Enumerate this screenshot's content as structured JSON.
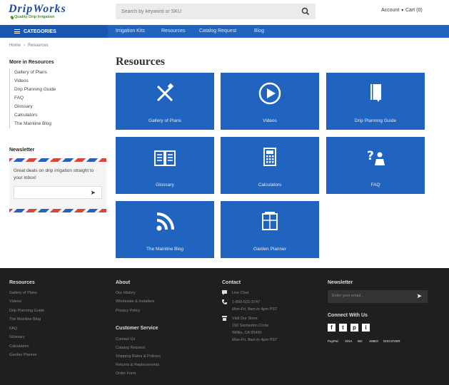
{
  "header": {
    "logo_text": "DripWorks",
    "logo_tagline": "Quality Drip Irrigation",
    "search_placeholder": "Search by keyword or SKU",
    "account_label": "Account",
    "cart_label": "Cart (0)"
  },
  "nav": {
    "categories_label": "CATEGORIES",
    "links": [
      "Irrigation Kits",
      "Resources",
      "Catalog Request",
      "Blog"
    ]
  },
  "breadcrumb": [
    "Home",
    "Resources"
  ],
  "sidebar": {
    "heading": "More in Resources",
    "items": [
      "Gallery of Plans",
      "Videos",
      "Drip Planning Guide",
      "FAQ",
      "Glossary",
      "Calculators",
      "The Mainline Blog"
    ],
    "newsletter_heading": "Newsletter",
    "newsletter_text": "Great deals on drip irrigation straight to your inbox!"
  },
  "main": {
    "title": "Resources",
    "tiles": [
      {
        "label": "Gallery of Plans",
        "icon": "pencil-ruler-icon"
      },
      {
        "label": "Videos",
        "icon": "play-icon"
      },
      {
        "label": "Drip Planning Guide",
        "icon": "book-download-icon"
      },
      {
        "label": "Glossary",
        "icon": "open-book-icon"
      },
      {
        "label": "Calculators",
        "icon": "calculator-icon"
      },
      {
        "label": "FAQ",
        "icon": "question-person-icon"
      },
      {
        "label": "The Mainline Blog",
        "icon": "rss-icon"
      },
      {
        "label": "Garden Planner",
        "icon": "planner-icon"
      }
    ]
  },
  "footer": {
    "resources_heading": "Resources",
    "resources_links": [
      "Gallery of Plans",
      "Videos",
      "Drip Planning Guide",
      "The Mainline Blog",
      "FAQ",
      "Glossary",
      "Calculators",
      "Garden Planner"
    ],
    "about_heading": "About",
    "about_links": [
      "Our History",
      "Wholesale & Installers",
      "Privacy Policy"
    ],
    "service_heading": "Customer Service",
    "service_links": [
      "Contact Us",
      "Catalog Request",
      "Shipping Rates & Policies",
      "Returns & Replacements",
      "Order Form"
    ],
    "contact_heading": "Contact",
    "live_chat": "Live Chat",
    "phone": "1-800-522-3747",
    "phone_hours": "Mon-Fri, 8am to 4pm PST",
    "store_label": "Visit Our Store",
    "store_address_1": "190 Sanhedrin Circle",
    "store_address_2": "Willits, CA 95490",
    "store_hours": "Mon-Fri, 8am to 4pm PST",
    "newsletter_heading": "Newsletter",
    "newsletter_placeholder": "Enter your email...",
    "connect_heading": "Connect With Us",
    "social": [
      "f",
      "t",
      "p",
      "i"
    ],
    "payments": [
      "PayPal",
      "VISA",
      "MC",
      "AMEX",
      "DISCOVER"
    ]
  },
  "colors": {
    "brand_blue": "#2164c0",
    "footer_bg": "#1f1f1f",
    "logo_green": "#4b8a2f"
  }
}
